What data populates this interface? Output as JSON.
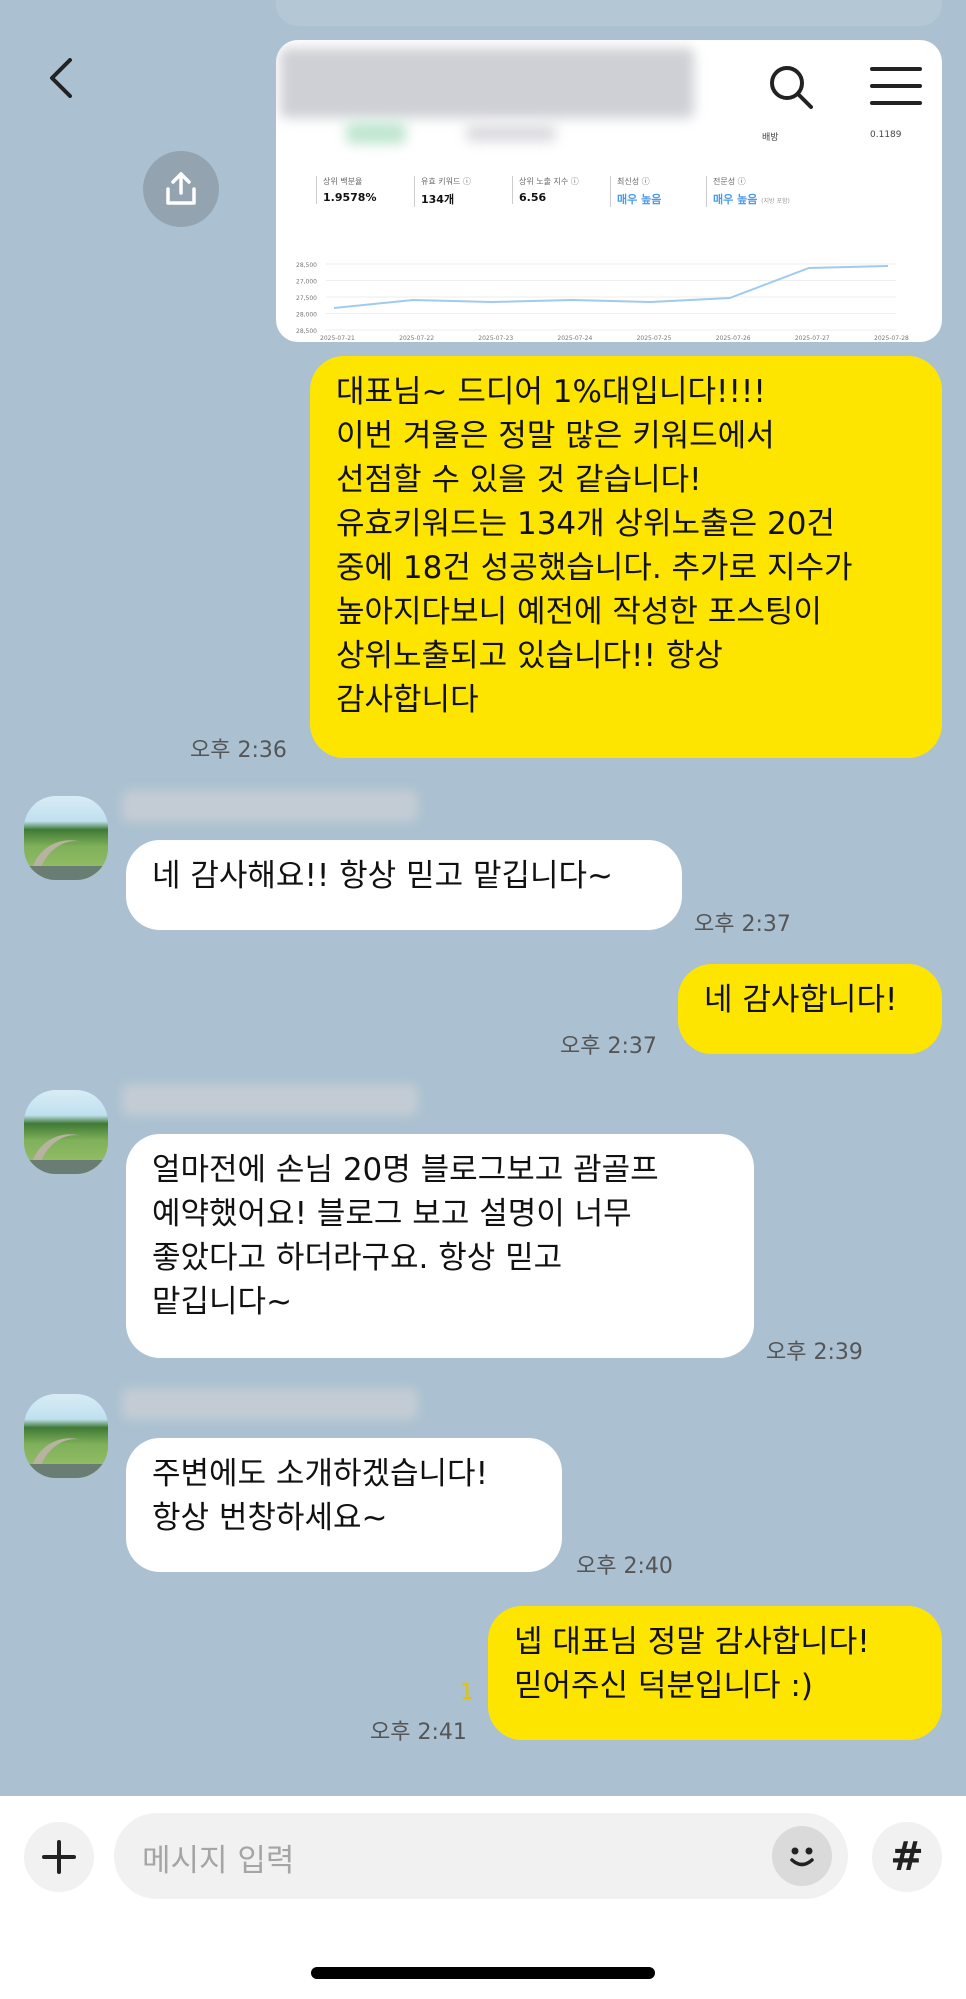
{
  "header": {
    "back_icon": "chevron-left-icon",
    "search_icon": "search-icon",
    "menu_icon": "hamburger-menu-icon"
  },
  "shared_image": {
    "header_right_label": "배방",
    "header_right_value": "0.1189",
    "stats": [
      {
        "label": "상위 백분율",
        "value": "1.9578%"
      },
      {
        "label": "유효 키워드 ⓘ",
        "value": "134개"
      },
      {
        "label": "상위 노출 지수 ⓘ",
        "value": "6.56"
      },
      {
        "label": "최신성 ⓘ",
        "value": "매우 높음"
      },
      {
        "label": "전문성 ⓘ",
        "value": "매우 높음",
        "note": "(지방 포함)"
      }
    ],
    "chart_data": {
      "type": "line",
      "x": [
        "2025-07-21",
        "2025-07-22",
        "2025-07-23",
        "2025-07-24",
        "2025-07-25",
        "2025-07-26",
        "2025-07-27",
        "2025-07-28"
      ],
      "yticks": [
        "28,500",
        "27,000",
        "27,500",
        "28,000",
        "28,500"
      ],
      "values": [
        28050,
        27850,
        27900,
        27850,
        27900,
        27800,
        27050,
        27000
      ],
      "color": "#9fcbef"
    }
  },
  "messages": [
    {
      "side": "me",
      "text": "대표님~ 드디어 1%대입니다!!!!\n이번 겨울은 정말 많은 키워드에서\n선점할 수 있을 것 같습니다!\n유효키워드는 134개 상위노출은 20건\n중에 18건 성공했습니다. 추가로 지수가\n높아지다보니 예전에 작성한 포스팅이\n상위노출되고 있습니다!! 항상\n감사합니다",
      "time": "오후 2:36"
    },
    {
      "side": "other",
      "text": "네 감사해요!! 항상 믿고 맡깁니다~",
      "time": "오후 2:37"
    },
    {
      "side": "me",
      "text": "네 감사합니다!",
      "time": "오후 2:37"
    },
    {
      "side": "other",
      "text": "얼마전에 손님 20명 블로그보고 괌골프\n예약했어요! 블로그 보고 설명이 너무\n좋았다고 하더라구요. 항상 믿고\n맡깁니다~",
      "time": "오후 2:39"
    },
    {
      "side": "other",
      "text": "주변에도 소개하겠습니다!\n항상 번창하세요~",
      "time": "오후 2:40"
    },
    {
      "side": "me",
      "text": "넵 대표님 정말 감사합니다!\n믿어주신 덕분입니다 :)",
      "time": "오후 2:41",
      "unread": "1"
    }
  ],
  "input": {
    "placeholder": "메시지 입력",
    "plus_icon": "plus-icon",
    "emoji_icon": "emoji-icon",
    "hash_label": "#"
  },
  "colors": {
    "background": "#abc1d1",
    "my_bubble": "#fee500",
    "other_bubble": "#ffffff"
  }
}
